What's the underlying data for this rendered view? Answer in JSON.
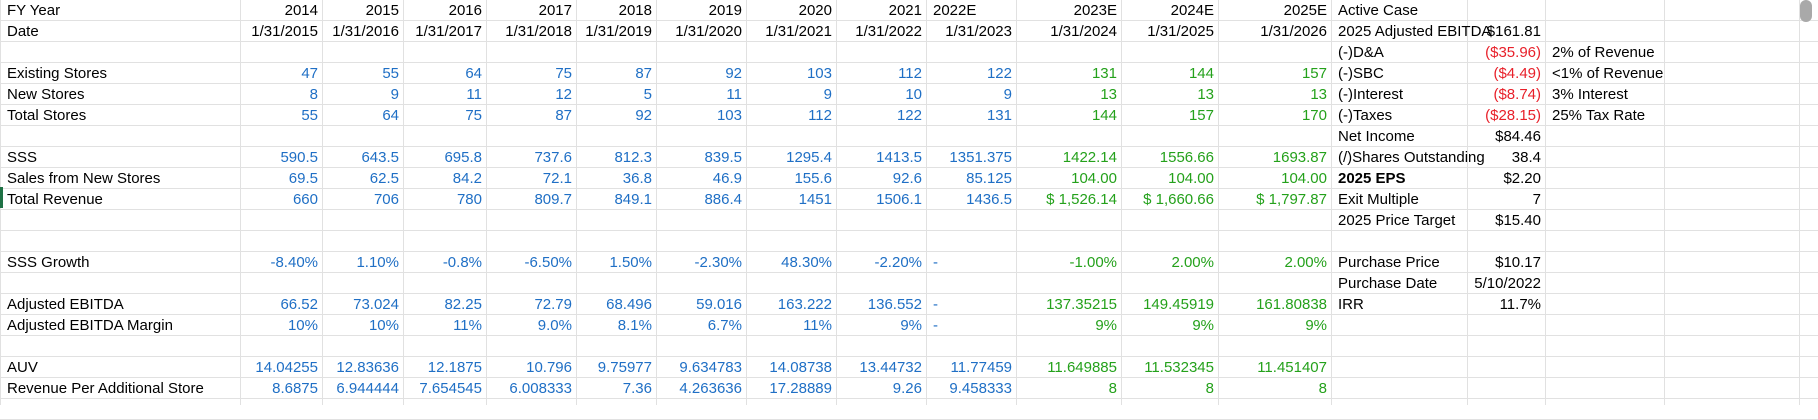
{
  "colors": {
    "input_blue": "#1f6fc5",
    "estimate_green": "#24a11b",
    "negative_red": "#e8202a",
    "gridline": "#e1e1e1"
  },
  "sheet": {
    "row_fy": {
      "label": "FY Year",
      "values": [
        "2014",
        "2015",
        "2016",
        "2017",
        "2018",
        "2019",
        "2020",
        "2021",
        "2022E",
        "2023E",
        "2024E",
        "2025E"
      ]
    },
    "row_date": {
      "label": "Date",
      "values": [
        "1/31/2015",
        "1/31/2016",
        "1/31/2017",
        "1/31/2018",
        "1/31/2019",
        "1/31/2020",
        "1/31/2021",
        "1/31/2022",
        "1/31/2023",
        "1/31/2024",
        "1/31/2025",
        "1/31/2026"
      ]
    },
    "row_existing": {
      "label": "Existing Stores",
      "values": [
        "47",
        "55",
        "64",
        "75",
        "87",
        "92",
        "103",
        "112",
        "122",
        "131",
        "144",
        "157"
      ]
    },
    "row_new": {
      "label": "New Stores",
      "values": [
        "8",
        "9",
        "11",
        "12",
        "5",
        "11",
        "9",
        "10",
        "9",
        "13",
        "13",
        "13"
      ]
    },
    "row_total_stores": {
      "label": "Total Stores",
      "values": [
        "55",
        "64",
        "75",
        "87",
        "92",
        "103",
        "112",
        "122",
        "131",
        "144",
        "157",
        "170"
      ]
    },
    "row_sss": {
      "label": "SSS",
      "values": [
        "590.5",
        "643.5",
        "695.8",
        "737.6",
        "812.3",
        "839.5",
        "1295.4",
        "1413.5",
        "1351.375",
        "1422.14",
        "1556.66",
        "1693.87"
      ]
    },
    "row_sales_new": {
      "label": "Sales from New Stores",
      "values": [
        "69.5",
        "62.5",
        "84.2",
        "72.1",
        "36.8",
        "46.9",
        "155.6",
        "92.6",
        "85.125",
        "104.00",
        "104.00",
        "104.00"
      ]
    },
    "row_total_rev": {
      "label": "Total Revenue",
      "values": [
        "660",
        "706",
        "780",
        "809.7",
        "849.1",
        "886.4",
        "1451",
        "1506.1",
        "1436.5",
        "$ 1,526.14",
        "$ 1,660.66",
        "$ 1,797.87"
      ]
    },
    "row_sss_growth": {
      "label": "SSS Growth",
      "values": [
        "-8.40%",
        "1.10%",
        "-0.8%",
        "-6.50%",
        "1.50%",
        "-2.30%",
        "48.30%",
        "-2.20%",
        "-",
        "-1.00%",
        "2.00%",
        "2.00%"
      ]
    },
    "row_ebitda": {
      "label": "Adjusted EBITDA",
      "values": [
        "66.52",
        "73.024",
        "82.25",
        "72.79",
        "68.496",
        "59.016",
        "163.222",
        "136.552",
        "-",
        "137.35215",
        "149.45919",
        "161.80838"
      ]
    },
    "row_margin": {
      "label": "Adjusted EBITDA Margin",
      "values": [
        "10%",
        "10%",
        "11%",
        "9.0%",
        "8.1%",
        "6.7%",
        "11%",
        "9%",
        "-",
        "9%",
        "9%",
        "9%"
      ]
    },
    "row_auv": {
      "label": "AUV",
      "values": [
        "14.04255",
        "12.83636",
        "12.1875",
        "10.796",
        "9.75977",
        "9.634783",
        "14.08738",
        "13.44732",
        "11.77459",
        "11.649885",
        "11.532345",
        "11.451407"
      ]
    },
    "row_rev_per_store": {
      "label": "Revenue Per Additional Store",
      "values": [
        "8.6875",
        "6.944444",
        "7.654545",
        "6.008333",
        "7.36",
        "4.263636",
        "17.28889",
        "9.26",
        "9.458333",
        "8",
        "8",
        "8"
      ]
    }
  },
  "valuation": {
    "header": "Active Case",
    "rows": [
      {
        "label": "2025 Adjusted EBITDA",
        "value": "$161.81",
        "note": ""
      },
      {
        "label": "(-)D&A",
        "value": "($35.96)",
        "note": "2% of Revenue"
      },
      {
        "label": "(-)SBC",
        "value": "($4.49)",
        "note": "<1% of  Revenue"
      },
      {
        "label": "(-)Interest",
        "value": "($8.74)",
        "note": "3% Interest"
      },
      {
        "label": "(-)Taxes",
        "value": "($28.15)",
        "note": "25% Tax Rate"
      },
      {
        "label": "Net Income",
        "value": "$84.46",
        "note": ""
      },
      {
        "label": "(/)Shares Outstanding",
        "value": "38.4",
        "note": ""
      },
      {
        "label": "2025 EPS",
        "value": "$2.20",
        "note": ""
      },
      {
        "label": "Exit Multiple",
        "value": "7",
        "note": ""
      },
      {
        "label": "2025 Price Target",
        "value": "$15.40",
        "note": ""
      }
    ],
    "purchase": [
      {
        "label": "Purchase Price",
        "value": "$10.17"
      },
      {
        "label": "Purchase Date",
        "value": "5/10/2022"
      },
      {
        "label": "IRR",
        "value": "11.7%"
      }
    ]
  }
}
